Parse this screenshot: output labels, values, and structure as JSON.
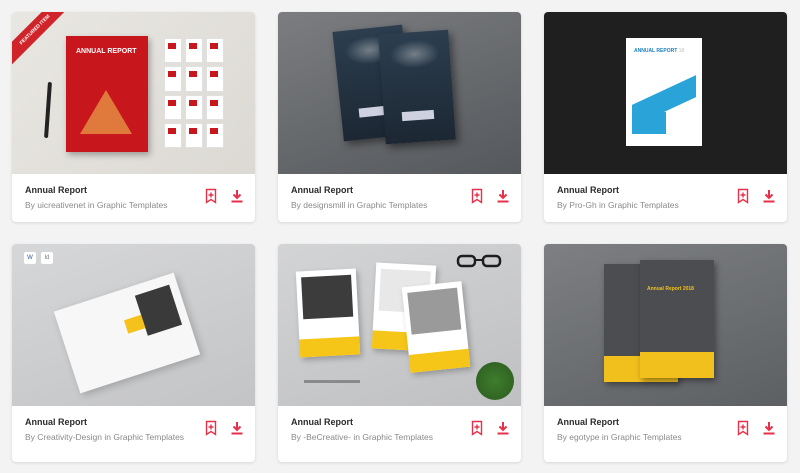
{
  "accent_color": "#e7304a",
  "cards": [
    {
      "title": "Annual Report",
      "author": "By uicreativenet in Graphic Templates",
      "thumb_ribbon": "FEATURED ITEM",
      "thumb_cover": "ANNUAL REPORT"
    },
    {
      "title": "Annual Report",
      "author": "By designsmill in Graphic Templates"
    },
    {
      "title": "Annual Report",
      "author": "By Pro-Gh in Graphic Templates",
      "thumb_cover": "ANNUAL REPORT",
      "thumb_cover_year": "18"
    },
    {
      "title": "Annual Report",
      "author": "By Creativity-Design in Graphic Templates",
      "thumb_badge_1": "W",
      "thumb_badge_2": "Id"
    },
    {
      "title": "Annual Report",
      "author": "By -BeCreative- in Graphic Templates"
    },
    {
      "title": "Annual Report",
      "author": "By egotype in Graphic Templates",
      "thumb_cover": "Annual Report 2018"
    }
  ],
  "icons": {
    "bookmark": "bookmark-add-icon",
    "download": "download-icon"
  }
}
